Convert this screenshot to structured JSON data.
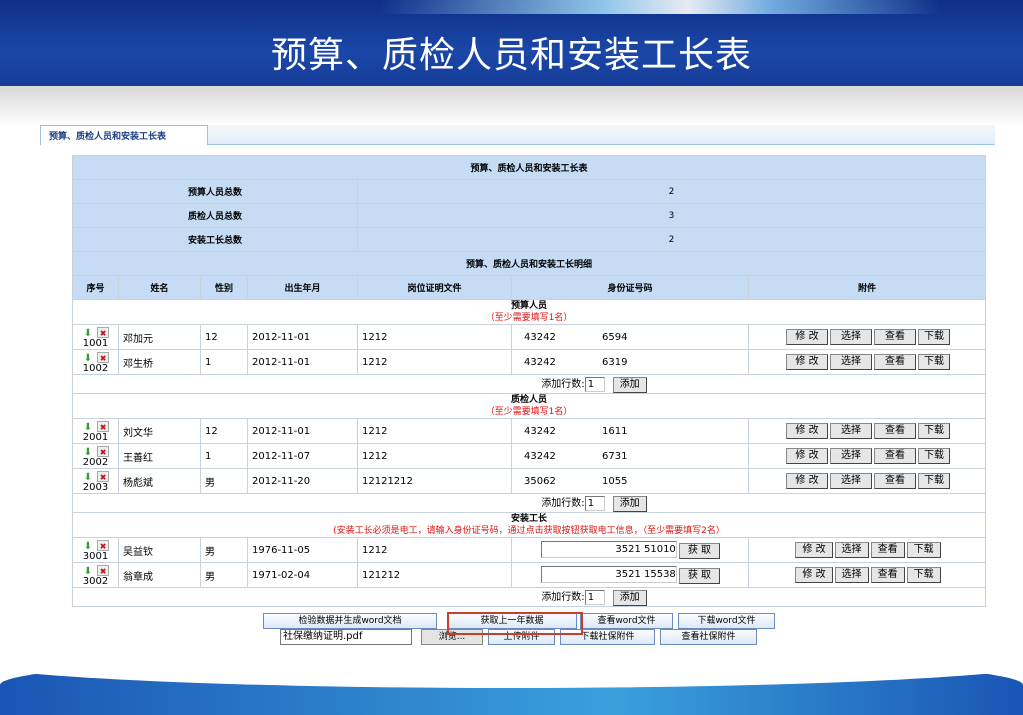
{
  "banner": {
    "title": "预算、质检人员和安装工长表"
  },
  "tab": {
    "label": "预算、质检人员和安装工长表"
  },
  "summary": {
    "title": "预算、质检人员和安装工长表",
    "rows": [
      {
        "label": "预算人员总数",
        "value": "2"
      },
      {
        "label": "质检人员总数",
        "value": "3"
      },
      {
        "label": "安装工长总数",
        "value": "2"
      }
    ]
  },
  "detail": {
    "title": "预算、质检人员和安装工长明细",
    "columns": [
      "序号",
      "姓名",
      "性别",
      "出生年月",
      "岗位证明文件",
      "身份证号码",
      "附件"
    ]
  },
  "buttons": {
    "modify": "修 改",
    "select": "选择",
    "view": "查看",
    "download": "下载",
    "fetch": "获 取",
    "add": "添加",
    "add_rows_label": "添加行数:",
    "add_rows_value": "1"
  },
  "sections": [
    {
      "title": "预算人员",
      "note": "（至少需要填写1名）",
      "rows": [
        {
          "seq": "1001",
          "name": "邓加元",
          "gender": "12",
          "birth": "2012-11-01",
          "cert": "1212",
          "id_a": "43242",
          "id_b": "6594"
        },
        {
          "seq": "1002",
          "name": "邓生桥",
          "gender": "1",
          "birth": "2012-11-01",
          "cert": "1212",
          "id_a": "43242",
          "id_b": "6319"
        }
      ]
    },
    {
      "title": "质检人员",
      "note": "（至少需要填写1名）",
      "rows": [
        {
          "seq": "2001",
          "name": "刘文华",
          "gender": "12",
          "birth": "2012-11-01",
          "cert": "1212",
          "id_a": "43242",
          "id_b": "1611"
        },
        {
          "seq": "2002",
          "name": "王善红",
          "gender": "1",
          "birth": "2012-11-07",
          "cert": "1212",
          "id_a": "43242",
          "id_b": "6731"
        },
        {
          "seq": "2003",
          "name": "杨彪斌",
          "gender": "男",
          "birth": "2012-11-20",
          "cert": "12121212",
          "id_a": "35062",
          "id_b": "1055"
        }
      ]
    },
    {
      "title": "安装工长",
      "note": "(安装工长必须是电工，请输入身份证号码，通过点击获取按钮获取电工信息，（至少需要填写2名）",
      "rows": [
        {
          "seq": "3001",
          "name": "吴益钦",
          "gender": "男",
          "birth": "1976-11-05",
          "cert": "1212",
          "id_value": "3521          51010"
        },
        {
          "seq": "3002",
          "name": "翁章成",
          "gender": "男",
          "birth": "1971-02-04",
          "cert": "121212",
          "id_value": "3521          15538"
        }
      ]
    }
  ],
  "footer": {
    "generate": "检验数据并生成word文档",
    "prev_year": "获取上一年数据",
    "view_word": "查看word文件",
    "download_word": "下载word文件",
    "file_value": "社保缴纳证明.pdf",
    "browse": "浏览...",
    "upload": "上传附件",
    "download_ss": "下载社保附件",
    "view_ss": "查看社保附件"
  },
  "colors": {
    "header_bg": "#c6dcf5",
    "banner": "#1b47a8",
    "note_red": "#e01010",
    "highlight": "#c8402c"
  }
}
